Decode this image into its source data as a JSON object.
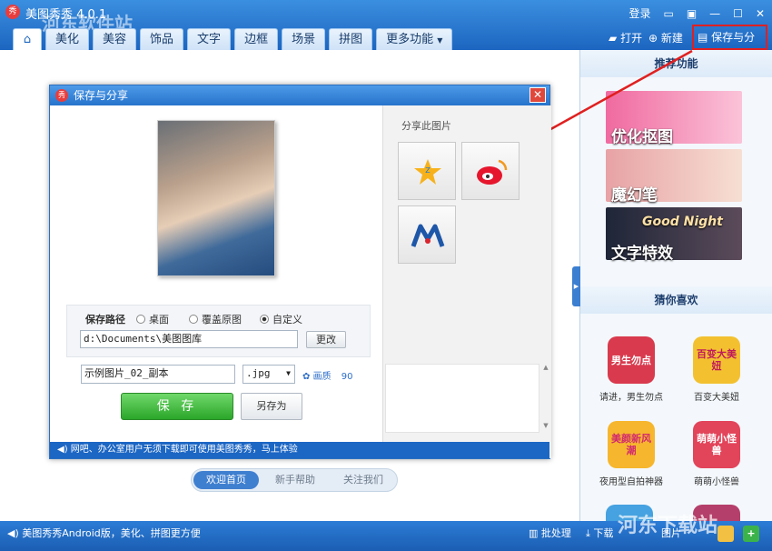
{
  "app": {
    "title": "美图秀秀 4.0.1",
    "logo": "秀"
  },
  "tabs": [
    "美化",
    "美容",
    "饰品",
    "文字",
    "边框",
    "场景",
    "拼图",
    "更多功能"
  ],
  "window_controls": {
    "login": "登录"
  },
  "toolbar": {
    "open": "打开",
    "new": "新建",
    "save_share": "保存与分享"
  },
  "right_panel": {
    "recommended_title": "推荐功能",
    "banners": [
      "优化抠图",
      "魔幻笔",
      "文字特效"
    ],
    "banner_extra": "Good Night",
    "guess_title": "猜你喜欢",
    "apps": [
      {
        "label": "请进，男生勿点",
        "icon": "男生勿点"
      },
      {
        "label": "百变大美妞",
        "icon": "百变大美妞"
      },
      {
        "label": "夜用型自拍神器",
        "icon": "美颜新风潮"
      },
      {
        "label": "萌萌小怪兽",
        "icon": "萌萌小怪兽"
      }
    ]
  },
  "dialog": {
    "title": "保存与分享",
    "logo": "秀",
    "close": "✕",
    "save_path_label": "保存路径",
    "options": [
      "桌面",
      "覆盖原图",
      "自定义"
    ],
    "path_value": "d:\\Documents\\美图图库",
    "change_button": "更改",
    "filename": "示例图片_02_副本",
    "format": ".jpg",
    "quality_label": "画质",
    "quality_value": "90",
    "save_button": "保 存",
    "save_as_button": "另存为",
    "share_title": "分享此图片",
    "footer": "网吧、办公室用户无须下载即可使用美图秀秀，马上体验"
  },
  "bottom_nav": {
    "items": [
      "欢迎首页",
      "新手帮助",
      "关注我们"
    ]
  },
  "statusbar": {
    "left": "美图秀秀Android版，美化、拼图更方便",
    "batch": "批处理",
    "download": "下载",
    "fragment": "图片"
  },
  "watermark": {
    "top": "河东软件站",
    "bottom": "河东下载站"
  }
}
